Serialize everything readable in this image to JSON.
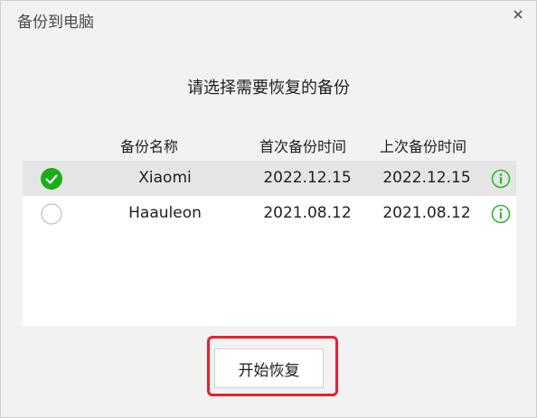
{
  "window": {
    "title": "备份到电脑",
    "close_icon": "close-icon"
  },
  "prompt": "请选择需要恢复的备份",
  "list": {
    "columns": [
      "备份名称",
      "首次备份时间",
      "上次备份时间"
    ],
    "rows": [
      {
        "name": "Xiaomi",
        "first_backup": "2022.12.15",
        "last_backup": "2022.12.15",
        "selected": true
      },
      {
        "name": "Haauleon",
        "first_backup": "2021.08.12",
        "last_backup": "2021.08.12",
        "selected": false
      }
    ]
  },
  "actions": {
    "start_label": "开始恢复"
  },
  "colors": {
    "accent_green": "#1aad19",
    "info_green": "#2eb82e",
    "highlight_red": "#e8202a",
    "selected_row": "#e5e5e5"
  }
}
